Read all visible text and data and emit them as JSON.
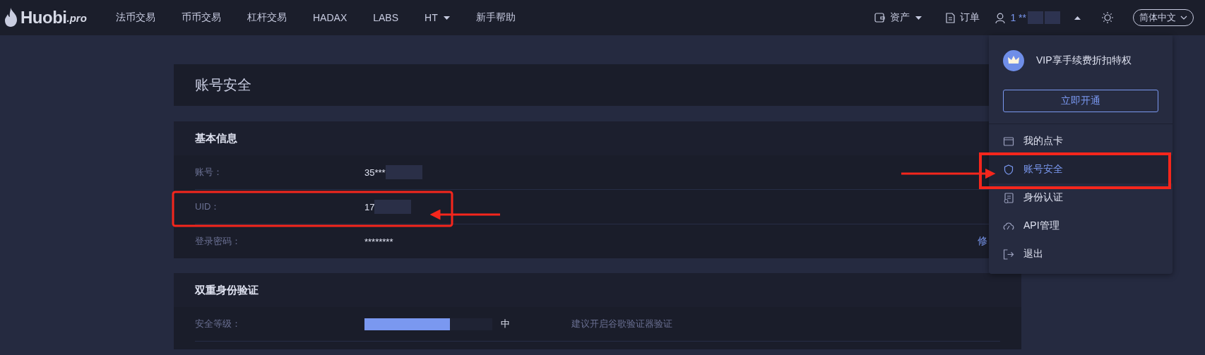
{
  "brand": {
    "name": "Huobi",
    "suffix": ".pro"
  },
  "nav": [
    {
      "label": "法币交易",
      "kind": "link"
    },
    {
      "label": "币币交易",
      "kind": "link"
    },
    {
      "label": "杠杆交易",
      "kind": "link"
    },
    {
      "label": "HADAX",
      "kind": "link"
    },
    {
      "label": "LABS",
      "kind": "link"
    },
    {
      "label": "HT",
      "kind": "menu"
    },
    {
      "label": "新手帮助",
      "kind": "link"
    }
  ],
  "header_right": {
    "assets": "资产",
    "orders": "订单",
    "username": "1 **",
    "language": "简体中文"
  },
  "page_title": "账号安全",
  "basic_info": {
    "title": "基本信息",
    "rows": [
      {
        "label": "账号：",
        "value": "35***"
      },
      {
        "label": "UID：",
        "value": "17"
      },
      {
        "label": "登录密码：",
        "value": "********",
        "action": "修"
      }
    ]
  },
  "two_factor": {
    "title": "双重身份验证",
    "security": {
      "label": "安全等级：",
      "level": 0.67,
      "reading": "中",
      "hint": "建议开启谷歌验证器验证"
    }
  },
  "user_menu": {
    "vip_text": "VIP享手续费折扣特权",
    "vip_button": "立即开通",
    "items": [
      {
        "label": "我的点卡",
        "selected": false
      },
      {
        "label": "账号安全",
        "selected": true
      },
      {
        "label": "身份认证",
        "selected": false
      },
      {
        "label": "API管理",
        "selected": false
      },
      {
        "label": "退出",
        "selected": false
      }
    ]
  }
}
